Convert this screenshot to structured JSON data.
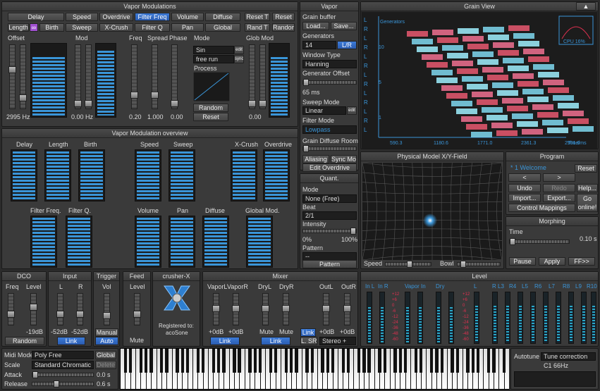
{
  "vapor_mod": {
    "title": "Vapor Modulations",
    "row1": [
      "Delay",
      "Speed",
      "Overdrive",
      "Filter Freq",
      "Volume",
      "Diffuse",
      "Reset T",
      "Reset"
    ],
    "row2": [
      "Length",
      "Birth",
      "Sweep",
      "X-Crush",
      "Filter Q",
      "Pan",
      "Global",
      "Rand T",
      "Random"
    ],
    "cols": [
      "Offset",
      "Mod",
      "Freq",
      "Spread",
      "Phase",
      "Mode",
      "Glob Mod"
    ],
    "offset_val": "2995 Hz",
    "mod_val": "0.00 Hz",
    "freq_val": "0.20",
    "spread_val": "1.000",
    "phase_val": "0.00",
    "globmod_val": "0.00",
    "mode_items": [
      "Sin",
      "free run",
      "Process"
    ],
    "edit": "edit",
    "sync": "sync",
    "random": "Random",
    "reset": "Reset"
  },
  "vapor": {
    "title": "Vapor",
    "grain_buffer": "Grain buffer",
    "load": "Load...",
    "save": "Save...",
    "generators": "Generators",
    "gen_val": "14",
    "lr": "L/R",
    "window_type": "Window Type",
    "window_val": "Hanning",
    "gen_offset": "Generator Offset",
    "offset_ms": "65 ms",
    "sweep_mode": "Sweep Mode",
    "sweep_val": "Linear",
    "edit": "edit",
    "filter_mode": "Filter Mode",
    "filter_val": "Lowpass",
    "diffuse_room": "Grain Diffuse Room",
    "aliasing": "Aliasing",
    "sync_mod": "Sync Mod",
    "edit_overdrive": "Edit Overdrive"
  },
  "grain": {
    "title": "Grain View",
    "generators": "Generators",
    "cpu": "CPU 16%",
    "time": "Time/ms",
    "xticks": [
      "590.3",
      "1180.6",
      "1771.0",
      "2361.3",
      "2951.6"
    ],
    "yticks": [
      "10",
      "5",
      "1"
    ],
    "lr": [
      "L",
      "R",
      "L",
      "R",
      "L",
      "R",
      "L",
      "R",
      "L",
      "R",
      "L",
      "R",
      "L"
    ]
  },
  "overview": {
    "title": "Vapor Modulation overview",
    "row1": [
      "Delay",
      "Length",
      "Birth",
      "Speed",
      "Sweep",
      "X-Crush",
      "Overdrive"
    ],
    "row2": [
      "Filter Freq.",
      "Filter Q.",
      "Volume",
      "Pan",
      "Diffuse",
      "Global Mod."
    ]
  },
  "quant": {
    "title": "Quant.",
    "mode": "Mode",
    "mode_val": "None (Free)",
    "beat": "Beat",
    "beat_val": "2/1",
    "intensity": "Intensity",
    "pct0": "0%",
    "pct100": "100%",
    "pattern": "Pattern",
    "pattern_val": "--",
    "pattern_btn": "Pattern"
  },
  "xy": {
    "title": "Physical Model X/Y-Field",
    "speed": "Speed",
    "bowl": "Bowl"
  },
  "program": {
    "title": "Program",
    "name": "* 1 Welcome",
    "reset": "Reset",
    "prev": "<",
    "next": ">",
    "undo": "Undo",
    "redo": "Redo",
    "help": "Help...",
    "import": "Import...",
    "export": "Export...",
    "go": "Go online!",
    "ctrl": "Control Mappings"
  },
  "morph": {
    "title": "Morphing",
    "time": "Time",
    "time_val": "0.10 s",
    "pause": "Pause",
    "apply": "Apply",
    "ff": "FF>>"
  },
  "dco": {
    "title": "DCO",
    "freq": "Freq",
    "level": "Level",
    "level_val": "-19dB",
    "random": "Random"
  },
  "input": {
    "title": "Input",
    "l": "L",
    "r": "R",
    "l_val": "-52dB",
    "r_val": "-52dB",
    "link": "Link"
  },
  "trigger": {
    "title": "Trigger",
    "vol": "Vol",
    "manual": "Manual",
    "auto": "Auto"
  },
  "feed": {
    "title": "Feed",
    "level": "Level",
    "mute": "Mute"
  },
  "crusher": {
    "title": "crusher-X",
    "reg": "Registered to:",
    "user": "acoSone"
  },
  "mixer": {
    "title": "Mixer",
    "cols": [
      "VaporL",
      "VaporR",
      "DryL",
      "DryR",
      "OutL",
      "OutR"
    ],
    "v1": "+0dB",
    "v2": "+0dB",
    "mute1": "Mute",
    "mute2": "Mute",
    "v3": "+0dB",
    "v4": "+0dB",
    "link1": "Link",
    "link2": "Link",
    "link3": "Link",
    "lr": "L. SR",
    "stereo": "Stereo +"
  },
  "level": {
    "title": "Level",
    "cols": [
      "In L",
      "In R",
      "Vapor In",
      "Dry",
      "L",
      "R",
      "L3",
      "R4",
      "L5",
      "R6",
      "L7",
      "R8",
      "L9",
      "R10"
    ],
    "scale": [
      "+12",
      "+6",
      "0",
      "-6",
      "-12",
      "-24",
      "-36",
      "-48",
      "-60"
    ]
  },
  "midi": {
    "midi_mode": "Midi Mode",
    "mode_val": "Poly Free",
    "global": "Global",
    "scale": "Scale",
    "scale_val": "Standard Chromatic",
    "delete": "Delete",
    "attack": "Attack",
    "attack_val": "0.0 s",
    "release": "Release",
    "release_val": "0.6 s"
  },
  "tune": {
    "autotune": "Autotune",
    "correction": "Tune correction",
    "note": "C1 66Hz"
  },
  "colors": {
    "accent": "#3a95d8",
    "panel": "#3a3a3a",
    "red": "#e03050"
  }
}
